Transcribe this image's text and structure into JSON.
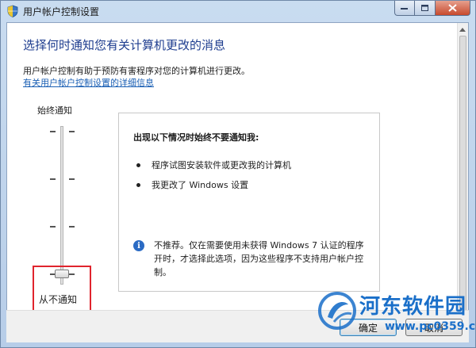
{
  "window": {
    "title": "用户帐户控制设置"
  },
  "main": {
    "heading": "选择何时通知您有关计算机更改的消息",
    "description": "用户帐户控制有助于预防有害程序对您的计算机进行更改。",
    "link": "有关用户帐户控制设置的详细信息"
  },
  "slider": {
    "top_label": "始终通知",
    "bottom_label": "从不通知",
    "levels": 4,
    "selected_level": 1
  },
  "info_panel": {
    "title": "出现以下情况时始终不要通知我:",
    "bullets": [
      "程序试图安装软件或更改我的计算机",
      "我更改了 Windows 设置"
    ],
    "note": "不推荐。仅在需要使用未获得 Windows 7 认证的程序开时，才选择此选项，因为这些程序不支持用户帐户控制。"
  },
  "buttons": {
    "ok": "确定",
    "cancel": "取消"
  },
  "watermark": {
    "text": "河东软件园",
    "url": "www.pc0359.cn"
  },
  "colors": {
    "heading": "#1e3d8f",
    "link": "#1a5fb4",
    "highlight": "#e0242d",
    "watermark": "#1a6fc9"
  }
}
